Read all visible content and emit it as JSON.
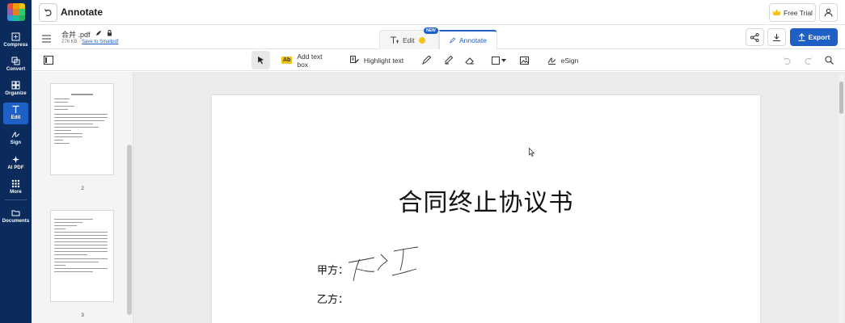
{
  "app": {
    "title": "Annotate",
    "free_trial_label": "Free Trial",
    "brand_color": "#1f60c6",
    "rail_color": "#0b2b5c"
  },
  "rail": {
    "items": [
      {
        "label": "Compress",
        "icon": "compress-icon"
      },
      {
        "label": "Convert",
        "icon": "convert-icon"
      },
      {
        "label": "Organize",
        "icon": "organize-icon"
      },
      {
        "label": "Edit",
        "icon": "text-edit-icon",
        "active": true
      },
      {
        "label": "Sign",
        "icon": "sign-icon"
      },
      {
        "label": "AI PDF",
        "icon": "ai-sparkle-icon"
      },
      {
        "label": "More",
        "icon": "grid-icon"
      },
      {
        "label": "Documents",
        "icon": "folder-icon"
      }
    ]
  },
  "file": {
    "name": "合并 .pdf",
    "size": "276 KB",
    "separator": "·",
    "save_link": "Save to Smallpdf"
  },
  "mode_tabs": {
    "edit_label": "Edit",
    "new_badge": "NEW",
    "annotate_label": "Annotate"
  },
  "actions": {
    "export_label": "Export"
  },
  "toolbar": {
    "add_text_box_label": "Add text box",
    "ab_glyph": "Ab",
    "highlight_text_label": "Highlight text",
    "esign_label": "eSign"
  },
  "thumbnails": [
    {
      "page_number": "2"
    },
    {
      "page_number": "3"
    }
  ],
  "document": {
    "title": "合同终止协议书",
    "party_a": "甲方：",
    "party_b": "乙方："
  }
}
